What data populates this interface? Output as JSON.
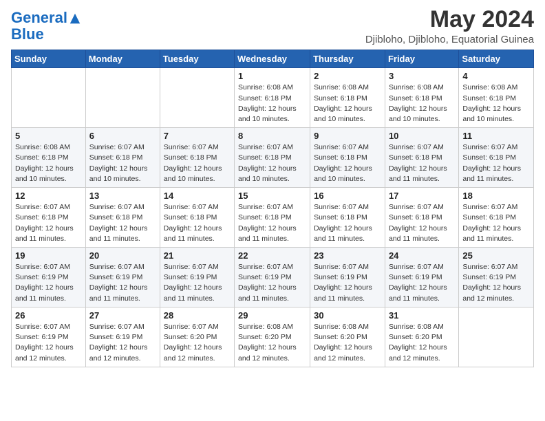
{
  "logo": {
    "line1": "General",
    "line2": "Blue"
  },
  "header": {
    "month_year": "May 2024",
    "location": "Djibloho, Djibloho, Equatorial Guinea"
  },
  "weekdays": [
    "Sunday",
    "Monday",
    "Tuesday",
    "Wednesday",
    "Thursday",
    "Friday",
    "Saturday"
  ],
  "weeks": [
    [
      {
        "day": "",
        "info": ""
      },
      {
        "day": "",
        "info": ""
      },
      {
        "day": "",
        "info": ""
      },
      {
        "day": "1",
        "info": "Sunrise: 6:08 AM\nSunset: 6:18 PM\nDaylight: 12 hours and 10 minutes."
      },
      {
        "day": "2",
        "info": "Sunrise: 6:08 AM\nSunset: 6:18 PM\nDaylight: 12 hours and 10 minutes."
      },
      {
        "day": "3",
        "info": "Sunrise: 6:08 AM\nSunset: 6:18 PM\nDaylight: 12 hours and 10 minutes."
      },
      {
        "day": "4",
        "info": "Sunrise: 6:08 AM\nSunset: 6:18 PM\nDaylight: 12 hours and 10 minutes."
      }
    ],
    [
      {
        "day": "5",
        "info": "Sunrise: 6:08 AM\nSunset: 6:18 PM\nDaylight: 12 hours and 10 minutes."
      },
      {
        "day": "6",
        "info": "Sunrise: 6:07 AM\nSunset: 6:18 PM\nDaylight: 12 hours and 10 minutes."
      },
      {
        "day": "7",
        "info": "Sunrise: 6:07 AM\nSunset: 6:18 PM\nDaylight: 12 hours and 10 minutes."
      },
      {
        "day": "8",
        "info": "Sunrise: 6:07 AM\nSunset: 6:18 PM\nDaylight: 12 hours and 10 minutes."
      },
      {
        "day": "9",
        "info": "Sunrise: 6:07 AM\nSunset: 6:18 PM\nDaylight: 12 hours and 10 minutes."
      },
      {
        "day": "10",
        "info": "Sunrise: 6:07 AM\nSunset: 6:18 PM\nDaylight: 12 hours and 11 minutes."
      },
      {
        "day": "11",
        "info": "Sunrise: 6:07 AM\nSunset: 6:18 PM\nDaylight: 12 hours and 11 minutes."
      }
    ],
    [
      {
        "day": "12",
        "info": "Sunrise: 6:07 AM\nSunset: 6:18 PM\nDaylight: 12 hours and 11 minutes."
      },
      {
        "day": "13",
        "info": "Sunrise: 6:07 AM\nSunset: 6:18 PM\nDaylight: 12 hours and 11 minutes."
      },
      {
        "day": "14",
        "info": "Sunrise: 6:07 AM\nSunset: 6:18 PM\nDaylight: 12 hours and 11 minutes."
      },
      {
        "day": "15",
        "info": "Sunrise: 6:07 AM\nSunset: 6:18 PM\nDaylight: 12 hours and 11 minutes."
      },
      {
        "day": "16",
        "info": "Sunrise: 6:07 AM\nSunset: 6:18 PM\nDaylight: 12 hours and 11 minutes."
      },
      {
        "day": "17",
        "info": "Sunrise: 6:07 AM\nSunset: 6:18 PM\nDaylight: 12 hours and 11 minutes."
      },
      {
        "day": "18",
        "info": "Sunrise: 6:07 AM\nSunset: 6:18 PM\nDaylight: 12 hours and 11 minutes."
      }
    ],
    [
      {
        "day": "19",
        "info": "Sunrise: 6:07 AM\nSunset: 6:19 PM\nDaylight: 12 hours and 11 minutes."
      },
      {
        "day": "20",
        "info": "Sunrise: 6:07 AM\nSunset: 6:19 PM\nDaylight: 12 hours and 11 minutes."
      },
      {
        "day": "21",
        "info": "Sunrise: 6:07 AM\nSunset: 6:19 PM\nDaylight: 12 hours and 11 minutes."
      },
      {
        "day": "22",
        "info": "Sunrise: 6:07 AM\nSunset: 6:19 PM\nDaylight: 12 hours and 11 minutes."
      },
      {
        "day": "23",
        "info": "Sunrise: 6:07 AM\nSunset: 6:19 PM\nDaylight: 12 hours and 11 minutes."
      },
      {
        "day": "24",
        "info": "Sunrise: 6:07 AM\nSunset: 6:19 PM\nDaylight: 12 hours and 11 minutes."
      },
      {
        "day": "25",
        "info": "Sunrise: 6:07 AM\nSunset: 6:19 PM\nDaylight: 12 hours and 12 minutes."
      }
    ],
    [
      {
        "day": "26",
        "info": "Sunrise: 6:07 AM\nSunset: 6:19 PM\nDaylight: 12 hours and 12 minutes."
      },
      {
        "day": "27",
        "info": "Sunrise: 6:07 AM\nSunset: 6:19 PM\nDaylight: 12 hours and 12 minutes."
      },
      {
        "day": "28",
        "info": "Sunrise: 6:07 AM\nSunset: 6:20 PM\nDaylight: 12 hours and 12 minutes."
      },
      {
        "day": "29",
        "info": "Sunrise: 6:08 AM\nSunset: 6:20 PM\nDaylight: 12 hours and 12 minutes."
      },
      {
        "day": "30",
        "info": "Sunrise: 6:08 AM\nSunset: 6:20 PM\nDaylight: 12 hours and 12 minutes."
      },
      {
        "day": "31",
        "info": "Sunrise: 6:08 AM\nSunset: 6:20 PM\nDaylight: 12 hours and 12 minutes."
      },
      {
        "day": "",
        "info": ""
      }
    ]
  ]
}
